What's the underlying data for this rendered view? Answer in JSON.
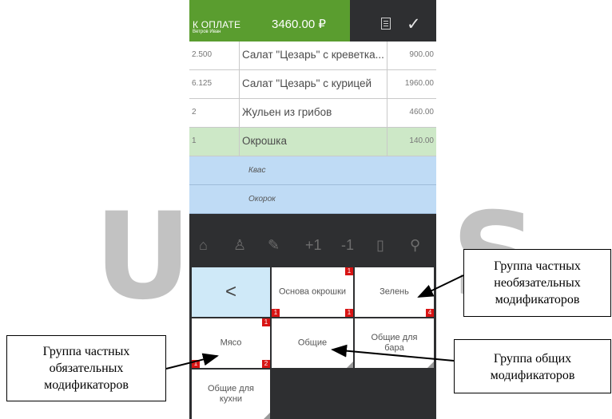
{
  "header": {
    "title": "К ОПЛАТЕ",
    "waiter": "Ветров Иван",
    "total": "3460.00 ₽",
    "accent_color": "#5a9d2f"
  },
  "order": {
    "rows": [
      {
        "qty": "2.500",
        "name": "Салат \"Цезарь\" с креветка...",
        "price": "900.00"
      },
      {
        "qty": "6.125",
        "name": "Салат \"Цезарь\" с курицей",
        "price": "1960.00"
      },
      {
        "qty": "2",
        "name": "Жульен из грибов",
        "price": "460.00"
      },
      {
        "qty": "1",
        "name": "Окрошка",
        "price": "140.00"
      }
    ],
    "modifiers": [
      "Квас",
      "Окорок"
    ]
  },
  "toolbar": {
    "icons": [
      "home-icon",
      "bottle-icon",
      "edit-icon",
      "plus-one",
      "minus-one",
      "trash-icon",
      "search-icon"
    ],
    "plus_label": "+1",
    "minus_label": "-1"
  },
  "tiles": {
    "back": "<",
    "osnova": "Основа окрошки",
    "osnova_top_badge": "1",
    "osnova_bl_badge": "1",
    "osnova_br_badge": "1",
    "zelen": "Зелень",
    "zelen_badge": "4",
    "myaso": "Мясо",
    "myaso_top_badge": "1",
    "myaso_bl_badge": "1",
    "myaso_br_badge": "2",
    "obshie": "Общие",
    "obshie_bar": "Общие для бара",
    "obshie_kuhni": "Общие для кухни"
  },
  "watermark": {
    "left": "U",
    "right": "S"
  },
  "callouts": {
    "optional": "Группа частных необязательных модификаторов",
    "required": "Группа частных обязательных модификаторов",
    "common": "Группа общих модификаторов"
  }
}
